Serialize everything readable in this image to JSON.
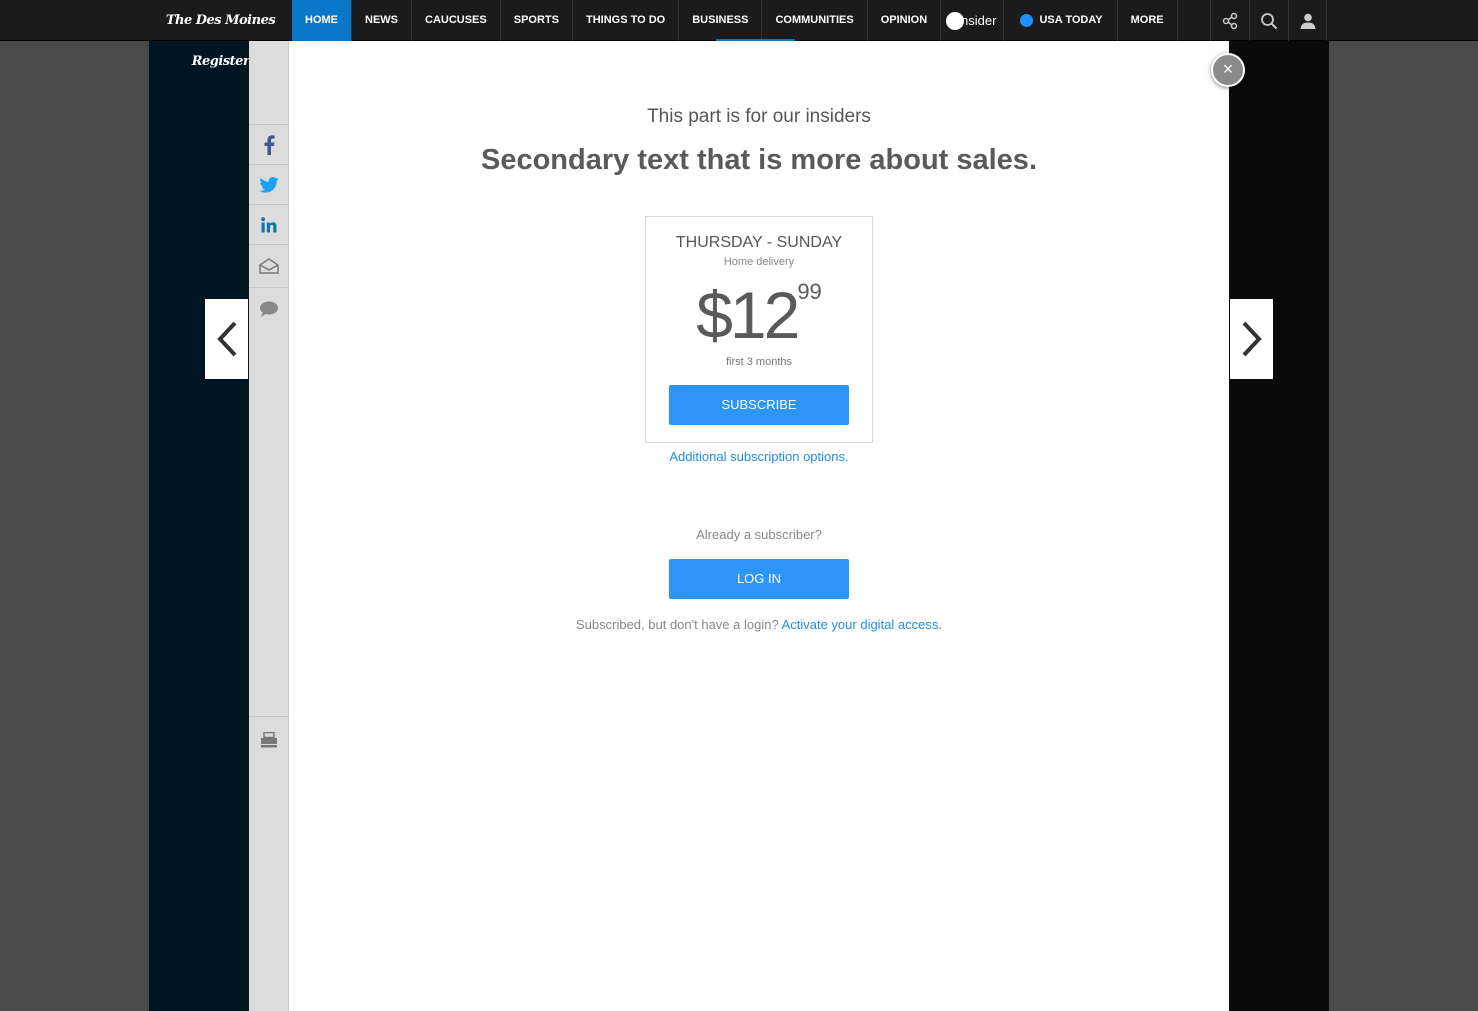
{
  "nav": {
    "brand": "The Des Moines Register",
    "items": [
      "HOME",
      "NEWS",
      "CAUCUSES",
      "SPORTS",
      "THINGS TO DO",
      "BUSINESS",
      "COMMUNITIES",
      "OPINION"
    ],
    "insider_label": "insider",
    "usatoday_label": "USA TODAY",
    "more_label": "MORE",
    "tools": [
      "share-icon",
      "search-icon",
      "user-icon"
    ]
  },
  "share_rail": [
    "facebook-icon",
    "twitter-icon",
    "linkedin-icon",
    "email-icon",
    "comment-icon",
    "print-icon"
  ],
  "modal": {
    "heading": "This part is for our insiders",
    "subheading": "Secondary text that is more about sales.",
    "close_symbol": "×",
    "offer": {
      "title": "THURSDAY - SUNDAY",
      "subtitle": "Home delivery",
      "price_dollars": "$12",
      "price_cents": "99",
      "note": "first 3 months",
      "button": "SUBSCRIBE"
    },
    "additional_options": "Additional subscription options.",
    "already_subscriber": "Already a subscriber?",
    "login_button": "LOG IN",
    "activate_prefix": "Subscribed, but don't have a login?",
    "activate_link": "Activate your digital access."
  },
  "colors": {
    "nav_bg": "#1b1b1b",
    "active_tab": "#0a78c8",
    "button_blue": "#2d95f5",
    "link_blue": "#1f8ee8",
    "twitter": "#1da1f2",
    "facebook": "#3b5998",
    "linkedin": "#0e76a8"
  }
}
